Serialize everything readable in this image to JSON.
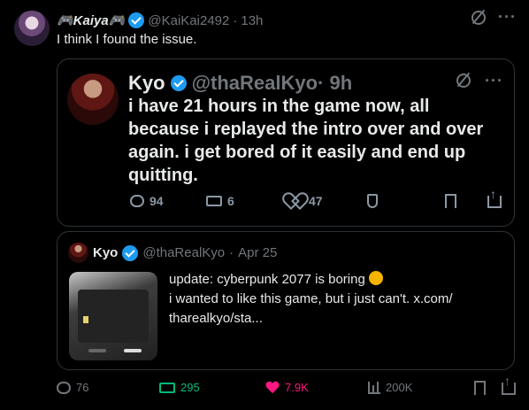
{
  "tweet": {
    "author_name": "🎮Kaiya🎮",
    "handle": "@KaiKai2492",
    "dot": "·",
    "time": "13h",
    "text": "I think I found the issue."
  },
  "quoted": {
    "author_name": "Kyo",
    "handle": "@thaRealKyo",
    "time": "· 9h",
    "text": "i have 21 hours in the game now, all because i replayed the intro over and over again. i get bored of it easily and end up quitting.",
    "replies": "94",
    "reposts": "6",
    "likes": "47"
  },
  "nested": {
    "author_name": "Kyo",
    "handle": "@thaRealKyo",
    "dot": "·",
    "date": "Apr 25",
    "text_line1": "update: cyberpunk 2077 is boring",
    "text_line2": "i wanted to like this game, but i just can't.  x.com/",
    "text_line3": "tharealkyo/sta..."
  },
  "stats": {
    "replies": "76",
    "reposts": "295",
    "likes": "7.9K",
    "views": "200K"
  },
  "colors": {
    "accent": "#1d9bf0",
    "retweet_green": "#00ba7c",
    "like_pink": "#f91880"
  }
}
